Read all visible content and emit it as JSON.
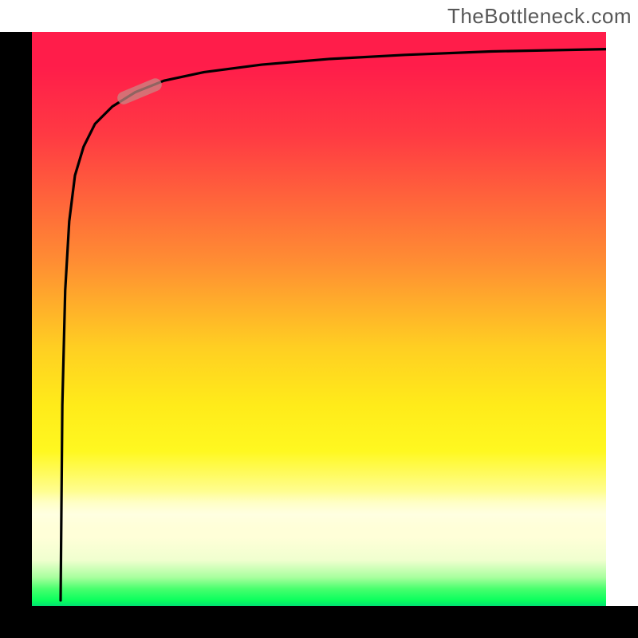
{
  "watermark": {
    "text": "TheBottleneck.com"
  },
  "chart_data": {
    "type": "line",
    "title": "",
    "xlabel": "",
    "ylabel": "",
    "xlim": [
      0,
      100
    ],
    "ylim": [
      0,
      100
    ],
    "gradient_stops": [
      {
        "pos": 0,
        "color": "#ff1d4a"
      },
      {
        "pos": 6,
        "color": "#ff1d4a"
      },
      {
        "pos": 18,
        "color": "#ff3a43"
      },
      {
        "pos": 40,
        "color": "#ff8d33"
      },
      {
        "pos": 55,
        "color": "#ffcf22"
      },
      {
        "pos": 65,
        "color": "#ffeb1a"
      },
      {
        "pos": 73,
        "color": "#fff820"
      },
      {
        "pos": 82,
        "color": "#ffffb0"
      },
      {
        "pos": 88,
        "color": "#ffffd8"
      },
      {
        "pos": 92,
        "color": "#f0ffcf"
      },
      {
        "pos": 95,
        "color": "#a8ff9e"
      },
      {
        "pos": 97,
        "color": "#48ff6e"
      },
      {
        "pos": 99,
        "color": "#0aff5d"
      },
      {
        "pos": 100,
        "color": "#00e272"
      }
    ],
    "series": [
      {
        "name": "curve",
        "x": [
          5,
          5.3,
          5.8,
          6.5,
          7.5,
          9,
          11,
          14,
          18,
          23,
          30,
          40,
          52,
          65,
          80,
          100
        ],
        "y": [
          1,
          35,
          55,
          67,
          75,
          80,
          84,
          87,
          89.5,
          91.5,
          93,
          94.3,
          95.3,
          96,
          96.6,
          97
        ]
      }
    ],
    "marker": {
      "x0": 16,
      "x1": 21.5,
      "y0": 88.5,
      "y1": 90.8,
      "color": "#c88a86",
      "opacity": 0.72
    }
  }
}
